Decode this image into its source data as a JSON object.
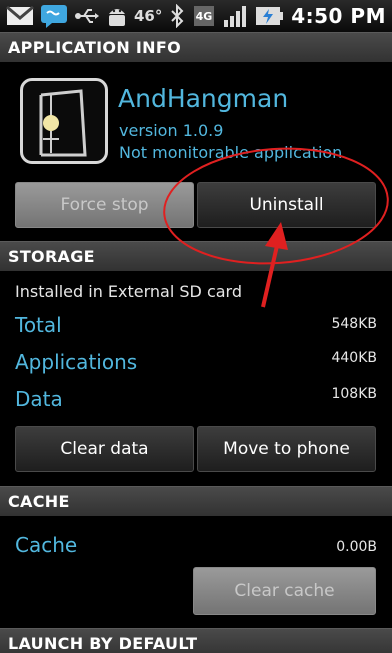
{
  "status_bar": {
    "icons": [
      "gmail-icon",
      "message-icon",
      "usb-icon",
      "android-debug-icon",
      "bluetooth-icon",
      "4g-icon",
      "signal-icon",
      "battery-charging-icon"
    ],
    "temperature": "46°",
    "network": "4G",
    "time": "4:50 PM"
  },
  "app_info": {
    "header": "APPLICATION INFO",
    "name": "AndHangman",
    "version": "version 1.0.9",
    "status": "Not monitorable application",
    "force_stop_label": "Force stop",
    "uninstall_label": "Uninstall"
  },
  "storage": {
    "header": "STORAGE",
    "location": "Installed in External SD card",
    "rows": [
      {
        "label": "Total",
        "value": "548KB"
      },
      {
        "label": "Applications",
        "value": "440KB"
      },
      {
        "label": "Data",
        "value": "108KB"
      }
    ],
    "clear_data_label": "Clear data",
    "move_label": "Move to phone"
  },
  "cache": {
    "header": "CACHE",
    "label": "Cache",
    "value": "0.00B",
    "clear_cache_label": "Clear cache"
  },
  "launch": {
    "header": "LAUNCH BY DEFAULT"
  },
  "colors": {
    "accent": "#52b7de",
    "annotation": "#e02020",
    "background": "#000000"
  }
}
